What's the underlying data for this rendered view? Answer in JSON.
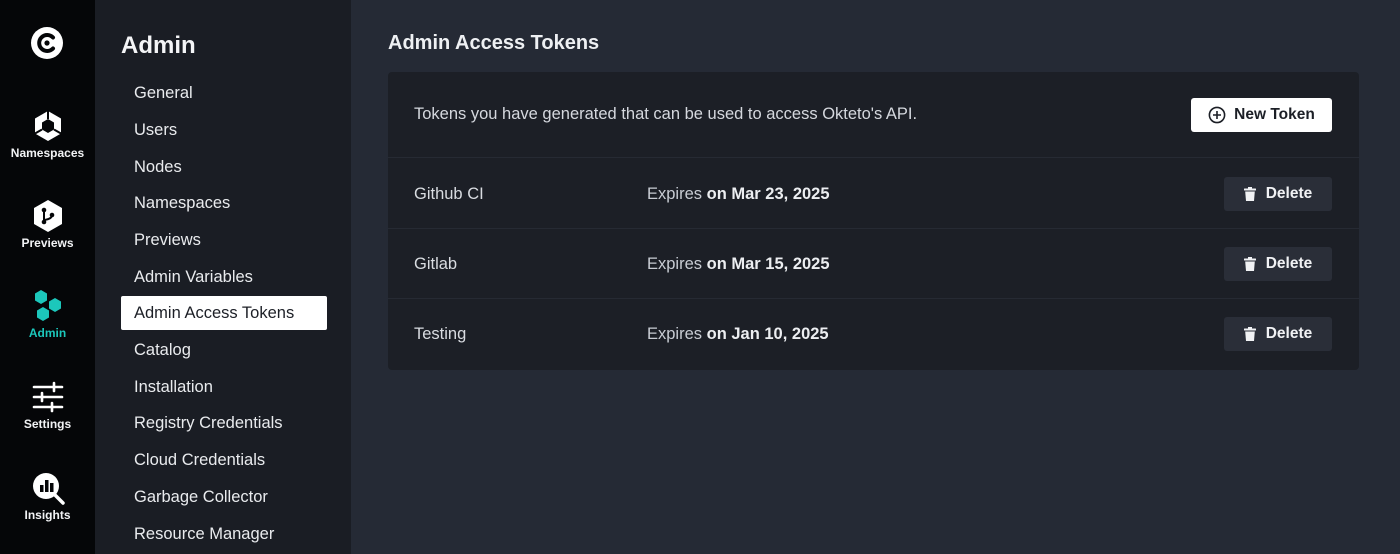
{
  "app": {
    "accent": "#1cc7bb"
  },
  "rail": {
    "items": [
      {
        "label": "Namespaces",
        "icon": "namespaces-icon"
      },
      {
        "label": "Previews",
        "icon": "previews-icon"
      },
      {
        "label": "Admin",
        "icon": "admin-icon",
        "active": true
      },
      {
        "label": "Settings",
        "icon": "settings-icon"
      },
      {
        "label": "Insights",
        "icon": "insights-icon"
      }
    ]
  },
  "subnav": {
    "title": "Admin",
    "items": [
      {
        "label": "General"
      },
      {
        "label": "Users"
      },
      {
        "label": "Nodes"
      },
      {
        "label": "Namespaces"
      },
      {
        "label": "Previews"
      },
      {
        "label": "Admin Variables"
      },
      {
        "label": "Admin Access Tokens",
        "active": true
      },
      {
        "label": "Catalog"
      },
      {
        "label": "Installation"
      },
      {
        "label": "Registry Credentials"
      },
      {
        "label": "Cloud Credentials"
      },
      {
        "label": "Garbage Collector"
      },
      {
        "label": "Resource Manager"
      }
    ]
  },
  "main": {
    "title": "Admin Access Tokens",
    "description": "Tokens you have generated that can be used to access Okteto's API.",
    "new_token_label": "New Token",
    "expires_prefix": "Expires",
    "delete_label": "Delete",
    "tokens": [
      {
        "name": "Github CI",
        "expires": "on Mar 23, 2025"
      },
      {
        "name": "Gitlab",
        "expires": "on Mar 15, 2025"
      },
      {
        "name": "Testing",
        "expires": "on Jan 10, 2025"
      }
    ]
  }
}
